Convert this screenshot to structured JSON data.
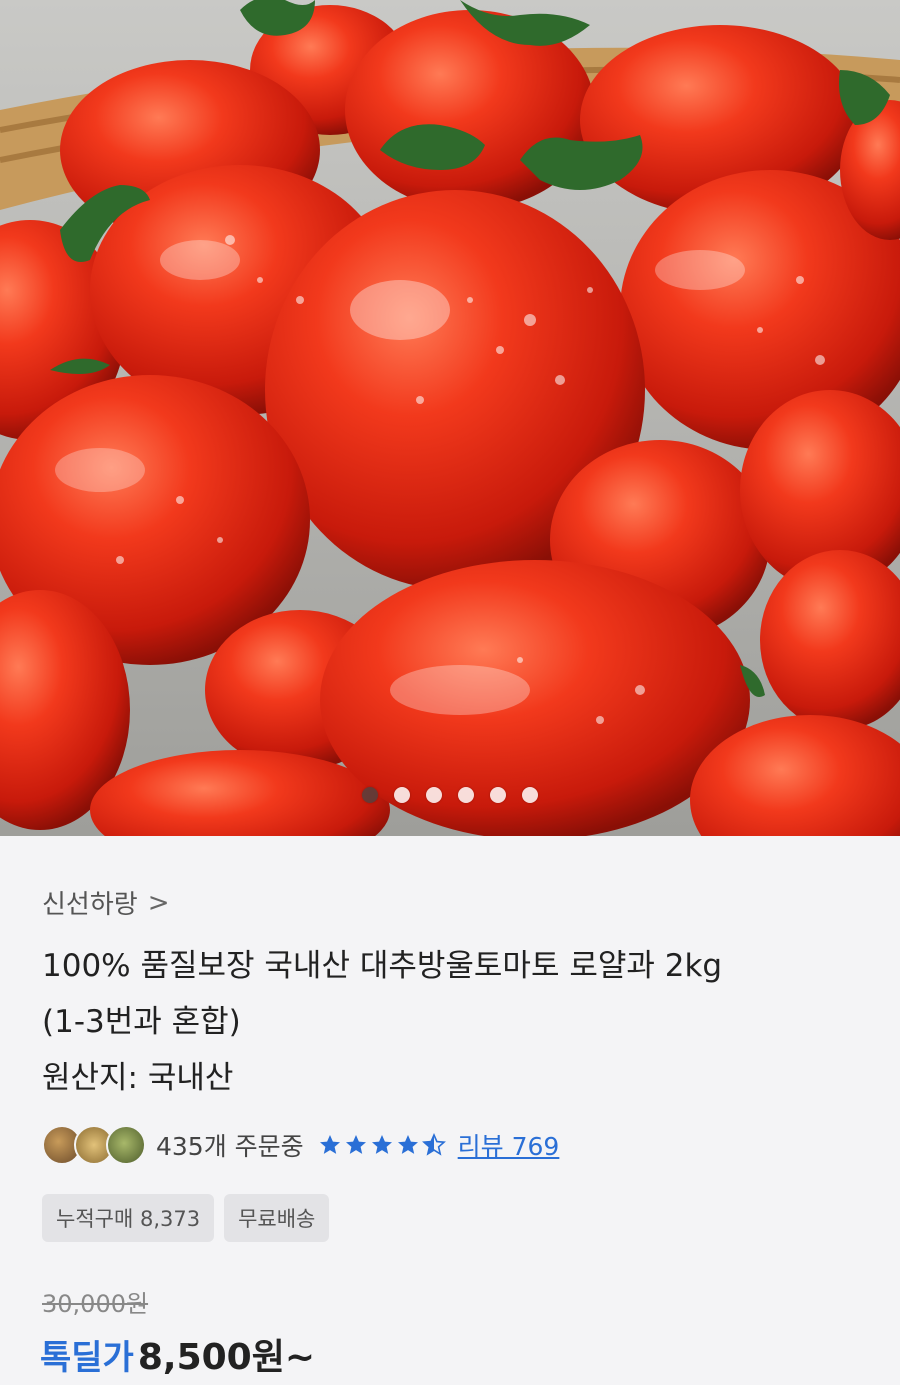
{
  "seller": {
    "name": "신선하랑",
    "chevron": ">"
  },
  "product": {
    "title_line1": "100% 품질보장 국내산 대추방울토마토 로얄과 2kg",
    "title_line2": "(1-3번과 혼합)",
    "origin": "원산지: 국내산"
  },
  "stats": {
    "orders": "435개 주문중",
    "rating": 4.5,
    "review_link": "리뷰 769"
  },
  "tags": [
    "누적구매 8,373",
    "무료배송"
  ],
  "price": {
    "original": "30,000원",
    "deal_label": "톡딜가",
    "deal_price": "8,500원~"
  },
  "carousel": {
    "total": 6,
    "active": 1
  },
  "colors": {
    "accent": "#2a6fd6",
    "star": "#2a6fd6",
    "tomato": "#e8321e"
  },
  "icons": {
    "chevron": "chevron-right-icon",
    "star": "star-icon"
  }
}
